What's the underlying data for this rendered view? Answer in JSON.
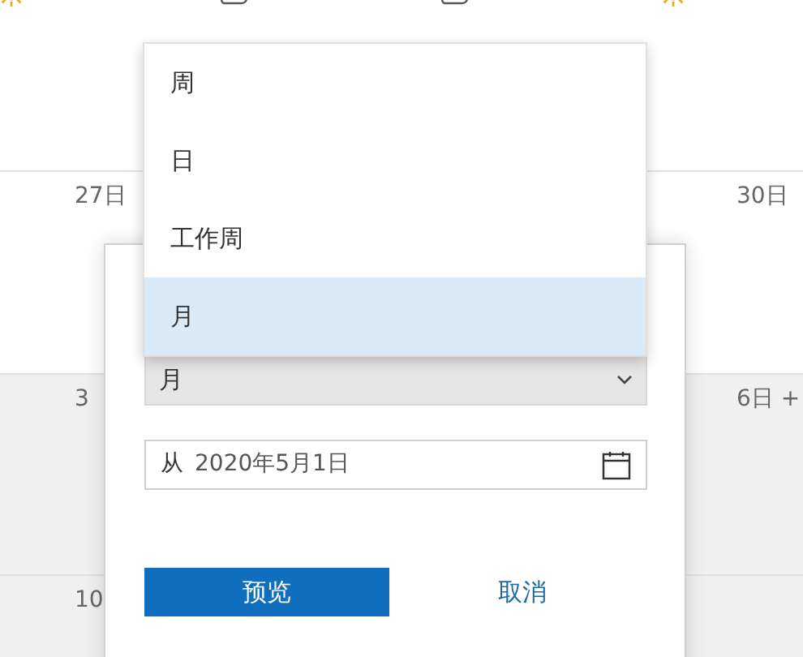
{
  "calendar": {
    "weeks": [
      {
        "other_month": false
      },
      {
        "other_month": false,
        "first_day": "27日",
        "last_day": "30日"
      },
      {
        "other_month": true,
        "first_day": "3",
        "last_day": "6日 +"
      },
      {
        "other_month": true,
        "first_day": "10"
      }
    ]
  },
  "dialog": {
    "view_select": {
      "value": "月"
    },
    "date_field": {
      "prefix": "从",
      "value": "2020年5月1日"
    },
    "buttons": [
      {
        "label": "预览",
        "kind": "primary"
      },
      {
        "label": "取消",
        "kind": "secondary"
      }
    ]
  },
  "dropdown": {
    "options": [
      {
        "label": "周",
        "selected": false
      },
      {
        "label": "日",
        "selected": false
      },
      {
        "label": "工作周",
        "selected": false
      },
      {
        "label": "月",
        "selected": true
      }
    ]
  }
}
